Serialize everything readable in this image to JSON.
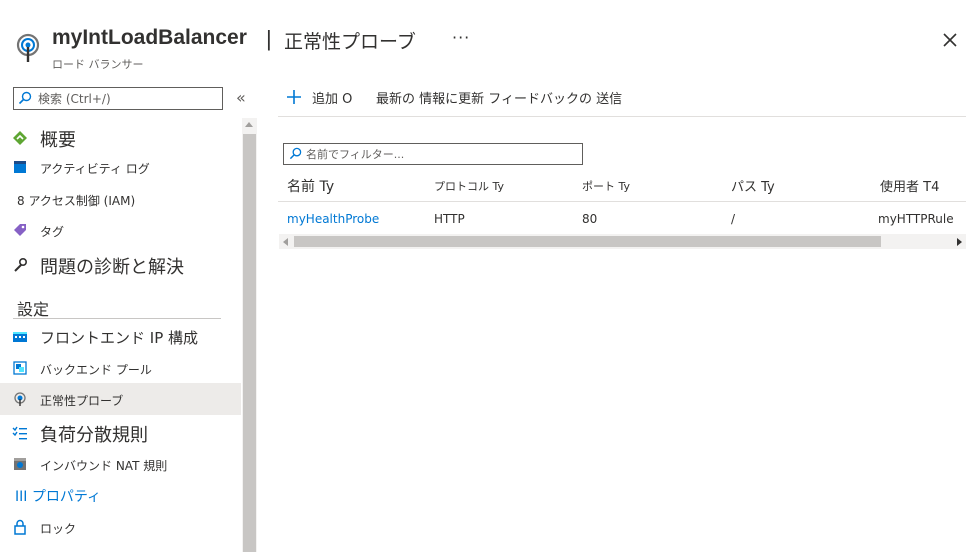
{
  "header": {
    "title": "myIntLoadBalancer",
    "separator": "|",
    "page_title": "正常性プローブ",
    "subtitle": "ロード バランサー",
    "more": "···",
    "icon": "load-balancer-icon",
    "close_icon": "close-icon"
  },
  "sidebar": {
    "search_placeholder": "検索 (Ctrl+/)",
    "collapse_label": "«",
    "items": [
      {
        "label": "概要",
        "icon": "overview-icon"
      },
      {
        "label": "アクティビティ ログ",
        "icon": "activity-log-icon"
      },
      {
        "label": "8 アクセス制御 (IAM)",
        "icon": "iam-icon"
      },
      {
        "label": "タグ",
        "icon": "tag-icon"
      },
      {
        "label": "問題の診断と解決",
        "icon": "wrench-icon"
      }
    ],
    "section": "設定",
    "settings_items": [
      {
        "label": "フロントエンド IP 構成",
        "icon": "frontend-ip-icon"
      },
      {
        "label": "バックエンド プール",
        "icon": "backend-pool-icon"
      },
      {
        "label": "正常性プローブ",
        "icon": "health-probe-icon",
        "selected": true
      },
      {
        "label": "負荷分散規則",
        "icon": "lb-rules-icon"
      },
      {
        "label": "インバウンド NAT 規則",
        "icon": "inbound-nat-icon"
      },
      {
        "label": "III プロパティ",
        "icon": "properties-icon"
      },
      {
        "label": "ロック",
        "icon": "lock-icon"
      }
    ]
  },
  "toolbar": {
    "add_label": "追加 O",
    "refresh_feedback_label": "最新の 情報に更新 フィードバックの 送信"
  },
  "filter": {
    "placeholder": "名前でフィルター..."
  },
  "table": {
    "columns": [
      "名前 Ty",
      "プロトコル Ty",
      "ポート Ty",
      "パス Ty",
      "使用者 T4"
    ],
    "rows": [
      [
        "myHealthProbe",
        "HTTP",
        "80",
        "/",
        "myHTTPRule"
      ]
    ]
  },
  "colors": {
    "link": "#0078d4",
    "accent": "#0078d4",
    "selected_bg": "#edebe9"
  }
}
